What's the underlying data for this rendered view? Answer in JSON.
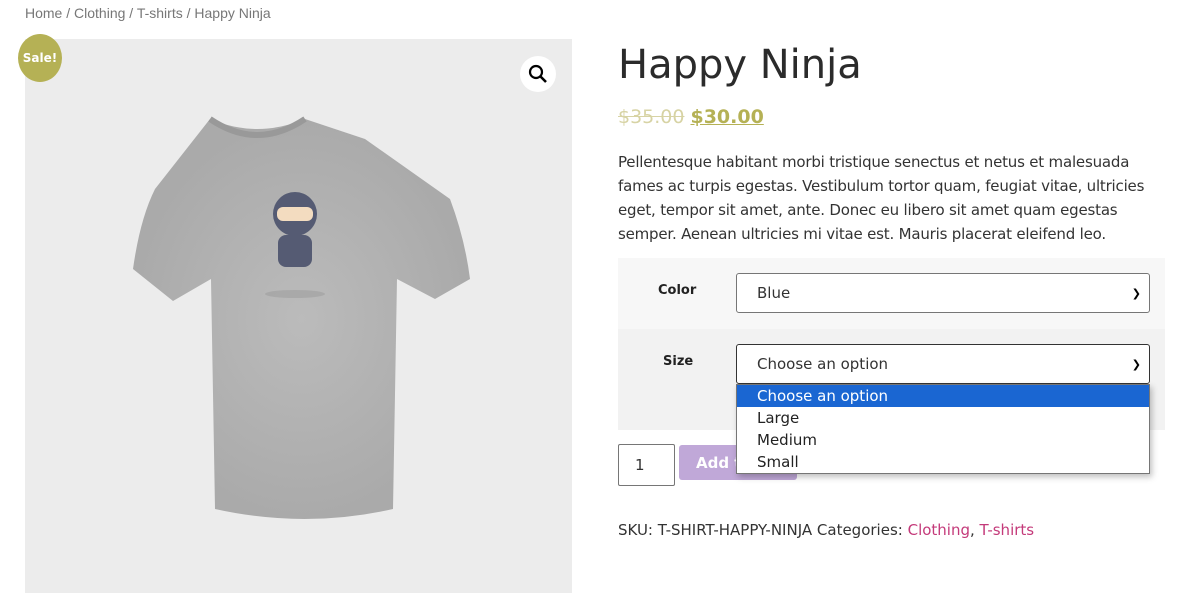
{
  "breadcrumb": {
    "items": [
      "Home",
      "Clothing",
      "T-shirts"
    ],
    "current": "Happy Ninja",
    "separator": " / "
  },
  "gallery": {
    "sale_badge": "Sale!",
    "zoom_icon": "magnifier-icon",
    "image": "grey t-shirt with ninja print"
  },
  "product": {
    "title": "Happy Ninja",
    "old_price": "$35.00",
    "price": "$30.00",
    "description": "Pellentesque habitant morbi tristique senectus et netus et malesuada fames ac turpis egestas. Vestibulum tortor quam, feugiat vitae, ultricies eget, tempor sit amet, ante. Donec eu libero sit amet quam egestas semper. Aenean ultricies mi vitae est. Mauris placerat eleifend leo."
  },
  "variations": {
    "color": {
      "label": "Color",
      "value": "Blue"
    },
    "size": {
      "label": "Size",
      "value": "Choose an option",
      "options": [
        "Choose an option",
        "Large",
        "Medium",
        "Small"
      ],
      "highlighted": "Choose an option"
    }
  },
  "cart": {
    "quantity": "1",
    "add_label": "Add to cart"
  },
  "meta": {
    "sku_label": "SKU:",
    "sku": "T-SHIRT-HAPPY-NINJA",
    "categories_label": "Categories:",
    "categories": [
      "Clothing",
      "T-shirts"
    ]
  },
  "colors": {
    "accent": "#b5b155",
    "link": "#c43a7a",
    "button": "#c0a8d8",
    "highlight": "#1a66d2"
  }
}
